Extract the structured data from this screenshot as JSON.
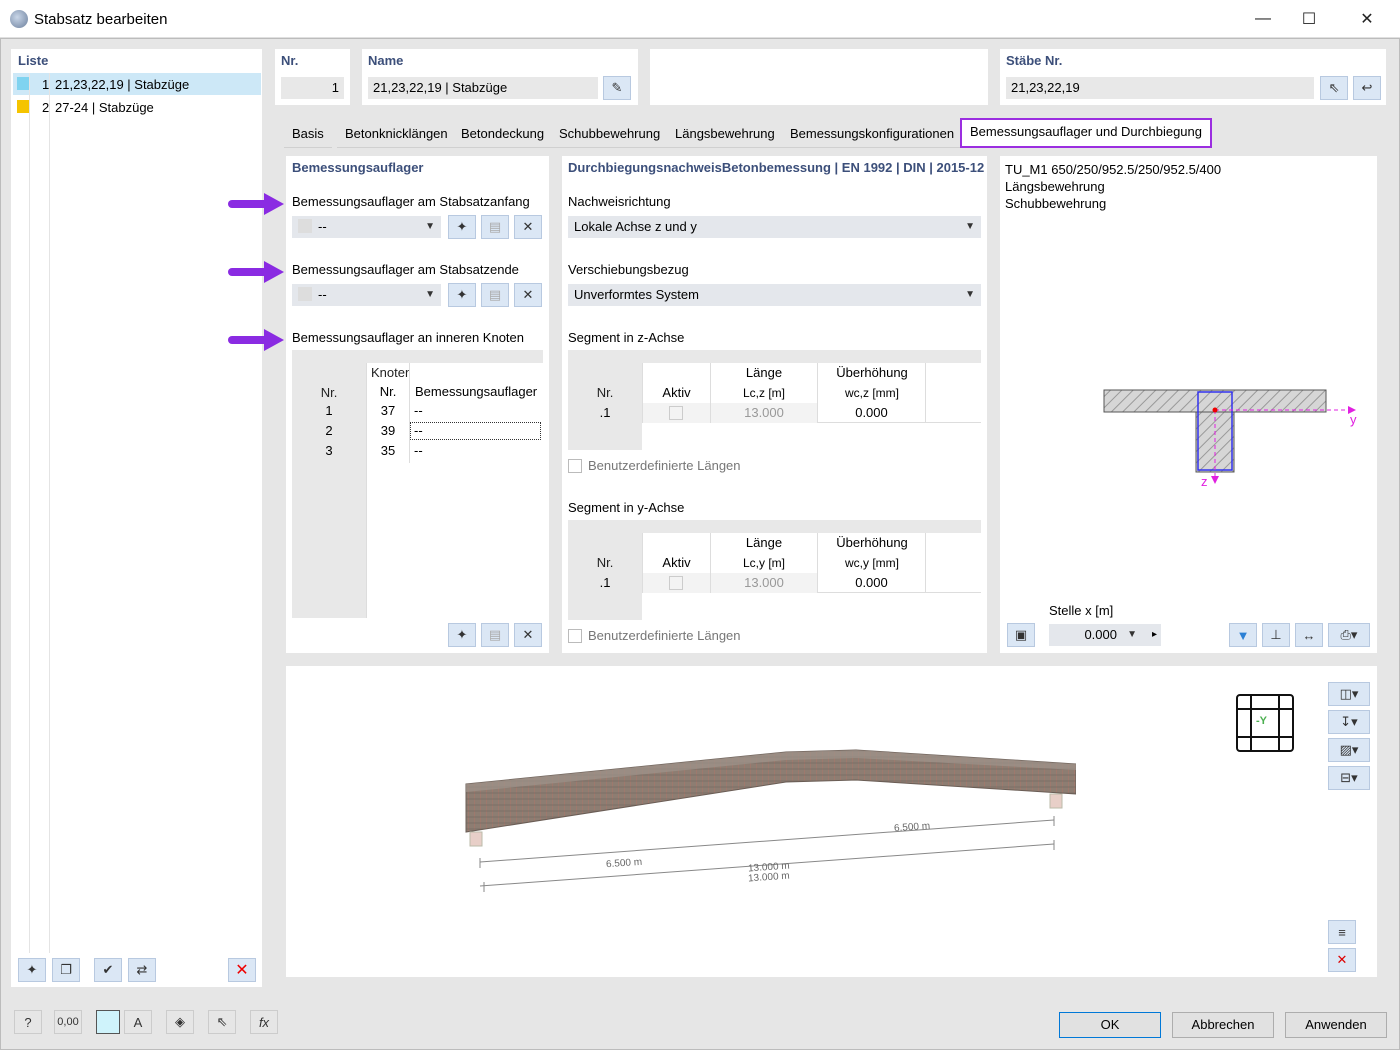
{
  "window": {
    "title": "Stabsatz bearbeiten",
    "min": "—",
    "max": "☐",
    "close": "✕"
  },
  "list": {
    "header": "Liste",
    "items": [
      {
        "num": "1",
        "label": "21,23,22,19 | Stabzüge",
        "color": "#7fd3f0",
        "selected": true
      },
      {
        "num": "2",
        "label": "27-24 | Stabzüge",
        "color": "#f5c400",
        "selected": false
      }
    ]
  },
  "fields": {
    "nr_label": "Nr.",
    "nr_value": "1",
    "name_label": "Name",
    "name_value": "21,23,22,19 | Stabzüge",
    "staebe_label": "Stäbe Nr.",
    "staebe_value": "21,23,22,19"
  },
  "tabs": [
    "Basis",
    "Betonknicklängen",
    "Betondeckung",
    "Schubbewehrung",
    "Längsbewehrung",
    "Bemessungskonfigurationen",
    "Bemessungsauflager und Durchbiegung"
  ],
  "supports": {
    "header": "Bemessungsauflager",
    "start_label": "Bemessungsauflager am Stabsatzanfang",
    "start_value": "--",
    "end_label": "Bemessungsauflager am Stabsatzende",
    "end_value": "--",
    "inner_label": "Bemessungsauflager an inneren Knoten",
    "col_nr": "Nr.",
    "col_knoten": "Knoten",
    "col_knoten_nr": "Nr.",
    "col_support": "Bemessungsauflager",
    "rows": [
      {
        "nr": "1",
        "knoten": "37",
        "val": "--"
      },
      {
        "nr": "2",
        "knoten": "39",
        "val": "--"
      },
      {
        "nr": "3",
        "knoten": "35",
        "val": "--"
      }
    ]
  },
  "deflection": {
    "header": "DurchbiegungsnachweisBetonbemessung | EN 1992 | DIN | 2015-12",
    "dir_label": "Nachweisrichtung",
    "dir_value": "Lokale Achse z und y",
    "ref_label": "Verschiebungsbezug",
    "ref_value": "Unverformtes System",
    "seg_z_label": "Segment in z-Achse",
    "seg_y_label": "Segment in y-Achse",
    "col_nr": "Nr.",
    "col_aktiv": "Aktiv",
    "col_laenge": "Länge",
    "col_ueber": "Überhöhung",
    "z_len_unit": "Lc,z [m]",
    "z_ueb_unit": "wc,z [mm]",
    "y_len_unit": "Lc,y [m]",
    "y_ueb_unit": "wc,y [mm]",
    "z_row": {
      "nr": ".1",
      "laenge": "13.000",
      "ueber": "0.000"
    },
    "y_row": {
      "nr": ".1",
      "laenge": "13.000",
      "ueber": "0.000"
    },
    "user_len": "Benutzerdefinierte Längen"
  },
  "section": {
    "line1": "TU_M1 650/250/952.5/250/952.5/400",
    "line2": "Längsbewehrung",
    "line3": "Schubbewehrung",
    "axis_y": "y",
    "axis_z": "z",
    "stelle_label": "Stelle x [m]",
    "stelle_value": "0.000"
  },
  "model3d": {
    "dim1": "6.500 m",
    "dim2": "6.500 m",
    "dim3": "13.000 m",
    "dim4": "13.000 m",
    "view_label": "-Y"
  },
  "buttons": {
    "ok": "OK",
    "cancel": "Abbrechen",
    "apply": "Anwenden"
  },
  "bottom_value": "0,00"
}
